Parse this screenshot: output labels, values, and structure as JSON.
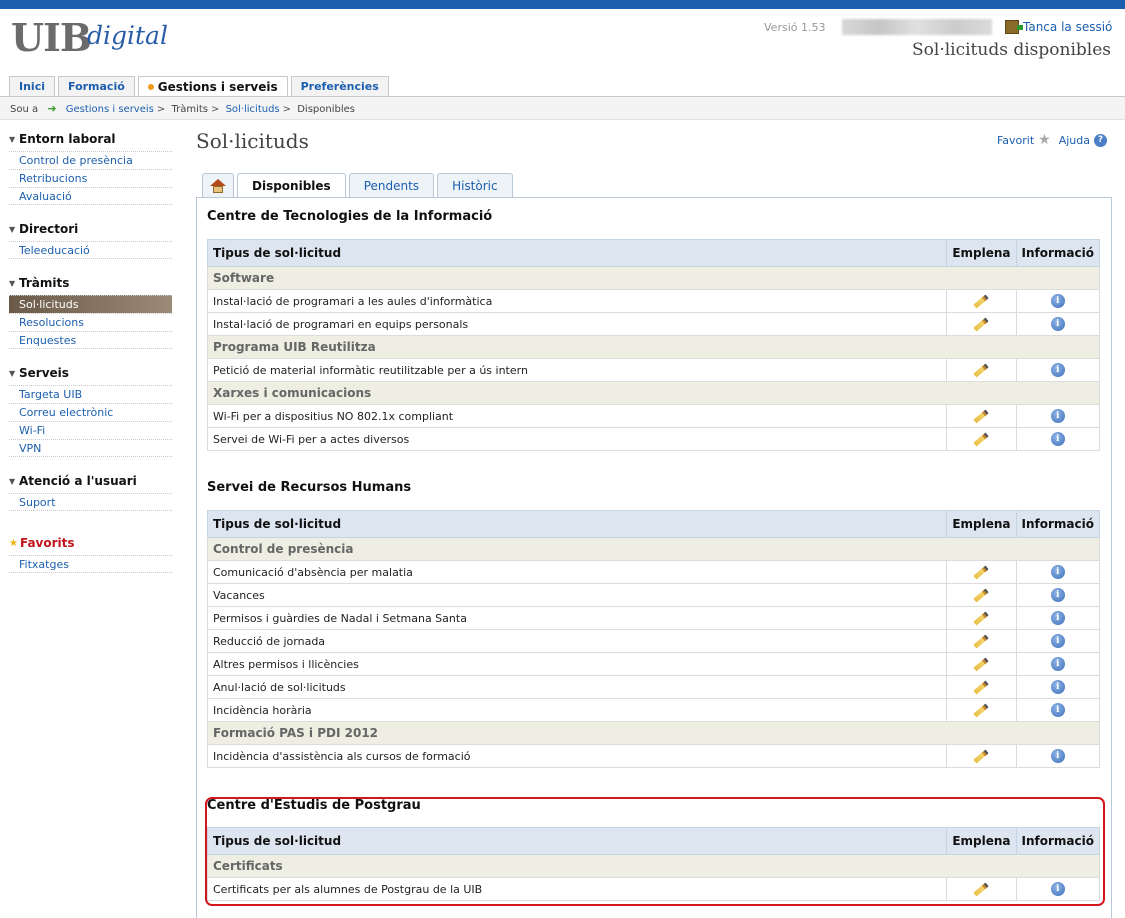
{
  "header": {
    "logo_main": "UIB",
    "logo_sub": "digital",
    "version": "Versió 1.53",
    "logout_label": "Tanca la sessió",
    "page_heading": "Sol·licituds disponibles"
  },
  "main_tabs": [
    "Inici",
    "Formació",
    "Gestions i serveis",
    "Preferències"
  ],
  "breadcrumb": {
    "prefix": "Sou a",
    "items": [
      "Gestions i serveis",
      "Tràmits",
      "Sol·licituds",
      "Disponibles"
    ]
  },
  "sidebar": {
    "groups": [
      {
        "title": "Entorn laboral",
        "items": [
          "Control de presència",
          "Retribucions",
          "Avaluació"
        ]
      },
      {
        "title": "Directori",
        "items": [
          "Teleeducació"
        ]
      },
      {
        "title": "Tràmits",
        "items": [
          "Sol·licituds",
          "Resolucions",
          "Enquestes"
        ]
      },
      {
        "title": "Serveis",
        "items": [
          "Targeta UIB",
          "Correu electrònic",
          "Wi-Fi",
          "VPN"
        ]
      },
      {
        "title": "Atenció a l'usuari",
        "items": [
          "Suport"
        ]
      },
      {
        "title": "Favorits",
        "items": [
          "Fitxatges"
        ]
      }
    ]
  },
  "content": {
    "title": "Sol·licituds",
    "favorite_label": "Favorit",
    "help_label": "Ajuda",
    "subtabs": [
      "Disponibles",
      "Pendents",
      "Històric"
    ]
  },
  "table_headers": {
    "type": "Tipus de sol·licitud",
    "fill": "Emplena",
    "info": "Informació"
  },
  "sections": [
    {
      "title": "Centre de Tecnologies de la Informació",
      "categories": [
        {
          "name": "Software",
          "rows": [
            "Instal·lació de programari a les aules d'informàtica",
            "Instal·lació de programari en equips personals"
          ]
        },
        {
          "name": "Programa UIB Reutilitza",
          "rows": [
            "Petició de material informàtic reutilitzable per a ús intern"
          ]
        },
        {
          "name": "Xarxes i comunicacions",
          "rows": [
            "Wi-Fi per a dispositius NO 802.1x compliant",
            "Servei de Wi-Fi per a actes diversos"
          ]
        }
      ]
    },
    {
      "title": "Servei de Recursos Humans",
      "categories": [
        {
          "name": "Control de presència",
          "rows": [
            "Comunicació d'absència per malatia",
            "Vacances",
            "Permisos i guàrdies de Nadal i Setmana Santa",
            "Reducció de jornada",
            "Altres permisos i llicències",
            "Anul·lació de sol·licituds",
            "Incidència horària"
          ]
        },
        {
          "name": "Formació PAS i PDI 2012",
          "rows": [
            "Incidència d'assistència als cursos de formació"
          ]
        }
      ]
    },
    {
      "title": "Centre d'Estudis de Postgrau",
      "categories": [
        {
          "name": "Certificats",
          "rows": [
            "Certificats per als alumnes de Postgrau de la UIB"
          ]
        }
      ]
    }
  ],
  "icons": {
    "home": "home-icon",
    "fill": "pencil-icon",
    "info": "info-icon",
    "logout": "logout-door-icon",
    "favorite": "star-icon",
    "help": "help-icon"
  },
  "colors": {
    "accent": "#1c5fae",
    "highlight_border": "#d4171d",
    "table_header_bg": "#dde6f0",
    "category_bg": "#eeeee2"
  }
}
